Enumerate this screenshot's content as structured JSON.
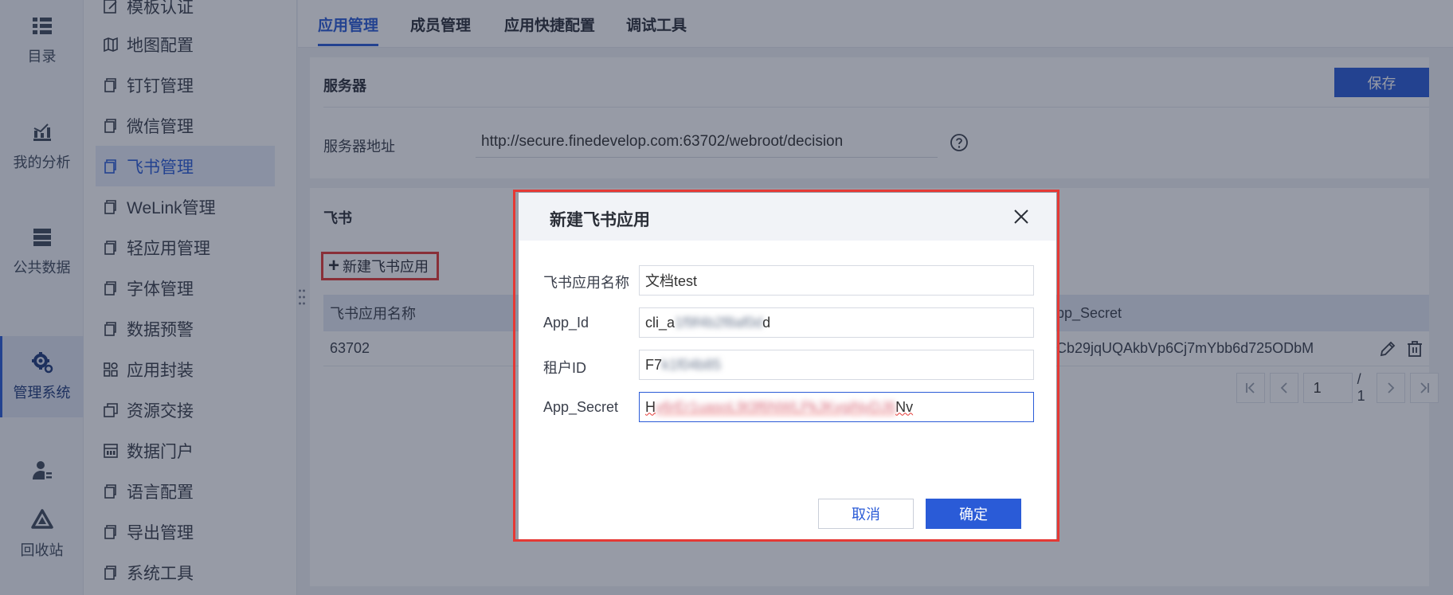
{
  "rail": {
    "items": [
      {
        "label": "目录",
        "icon": "list-icon"
      },
      {
        "label": "我的分析",
        "icon": "analysis-chart-icon"
      },
      {
        "label": "公共数据",
        "icon": "database-icon"
      },
      {
        "label": "管理系统",
        "icon": "gear-icon",
        "active": true
      },
      {
        "label": "",
        "icon": "user-icon"
      },
      {
        "label": "回收站",
        "icon": "recycle-icon"
      }
    ]
  },
  "subnav": {
    "items": [
      {
        "label": "模板认证",
        "icon": "edit-doc-icon"
      },
      {
        "label": "地图配置",
        "icon": "map-icon"
      },
      {
        "label": "钉钉管理",
        "icon": "copy-doc-icon"
      },
      {
        "label": "微信管理",
        "icon": "copy-doc-icon"
      },
      {
        "label": "飞书管理",
        "icon": "copy-doc-icon",
        "active": true
      },
      {
        "label": "WeLink管理",
        "icon": "copy-doc-icon"
      },
      {
        "label": "轻应用管理",
        "icon": "copy-doc-icon"
      },
      {
        "label": "字体管理",
        "icon": "copy-doc-icon"
      },
      {
        "label": "数据预警",
        "icon": "copy-doc-icon"
      },
      {
        "label": "应用封装",
        "icon": "grid-icon"
      },
      {
        "label": "资源交接",
        "icon": "exchange-icon"
      },
      {
        "label": "数据门户",
        "icon": "portal-icon"
      },
      {
        "label": "语言配置",
        "icon": "copy-doc-icon"
      },
      {
        "label": "导出管理",
        "icon": "copy-doc-icon"
      },
      {
        "label": "系统工具",
        "icon": "copy-doc-icon"
      }
    ]
  },
  "tabs": [
    {
      "label": "应用管理",
      "active": true
    },
    {
      "label": "成员管理"
    },
    {
      "label": "应用快捷配置"
    },
    {
      "label": "调试工具"
    }
  ],
  "server": {
    "title": "服务器",
    "save_label": "保存",
    "address_label": "服务器地址",
    "address_value": "http://secure.finedevelop.com:63702/webroot/decision"
  },
  "feishu": {
    "title": "飞书",
    "add_label": "新建飞书应用",
    "table": {
      "headers": [
        "飞书应用名称",
        "pp_Secret"
      ],
      "rows": [
        {
          "name": "63702",
          "secret": "Cb29jqUQAkbVp6Cj7mYbb6d725ODbM"
        }
      ]
    },
    "pager": {
      "page": "1",
      "total": "/ 1"
    }
  },
  "modal": {
    "title": "新建飞书应用",
    "fields": {
      "name_label": "飞书应用名称",
      "name_value": "文档test",
      "appid_label": "App_Id",
      "appid_prefix": "cli_a",
      "appid_blur": "1f9f4b2f8af0d",
      "appid_suffix": "d",
      "tenant_label": "租户ID",
      "tenant_prefix": "F7",
      "tenant_blur": "k1f04b85",
      "secret_label": "App_Secret",
      "secret_prefix": "H",
      "secret_blur": "y6rEr1uasoL9t3f6NWLPkJKvgiNyDJ6",
      "secret_suffix": "Nv"
    },
    "cancel_label": "取消",
    "ok_label": "确定"
  }
}
